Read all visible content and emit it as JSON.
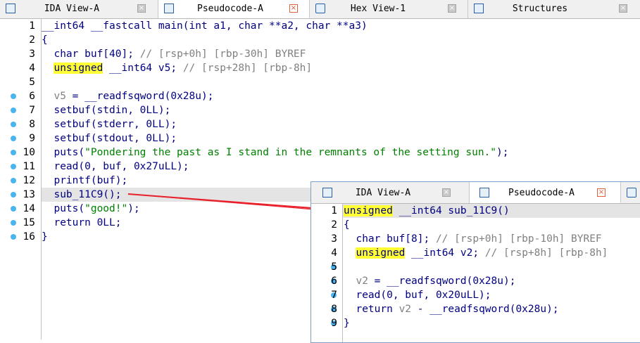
{
  "main_tabs": [
    {
      "label": "IDA View-A",
      "icon": "graph-view-icon",
      "active": false
    },
    {
      "label": "Pseudocode-A",
      "icon": "pseudocode-icon",
      "active": true
    },
    {
      "label": "Hex View-1",
      "icon": "hex-view-icon",
      "active": false
    },
    {
      "label": "Structures",
      "icon": "structures-icon",
      "active": false
    }
  ],
  "main_code": {
    "line_numbers": [
      "1",
      "2",
      "3",
      "4",
      "5",
      "6",
      "7",
      "8",
      "9",
      "10",
      "11",
      "12",
      "13",
      "14",
      "15",
      "16"
    ],
    "lines": [
      [
        {
          "t": "__int64 __fastcall main(int a1, char **a2, char **a3)",
          "c": ""
        }
      ],
      [
        {
          "t": "{",
          "c": ""
        }
      ],
      [
        {
          "t": "  char buf[40]; ",
          "c": ""
        },
        {
          "t": "// [rsp+0h] [rbp-30h] BYREF",
          "c": "cm"
        }
      ],
      [
        {
          "t": "  ",
          "c": ""
        },
        {
          "t": "unsigned",
          "c": "kw"
        },
        {
          "t": " __int64 v5; ",
          "c": ""
        },
        {
          "t": "// [rsp+28h] [rbp-8h]",
          "c": "cm"
        }
      ],
      [
        {
          "t": "",
          "c": ""
        }
      ],
      [
        {
          "t": "  ",
          "c": ""
        },
        {
          "t": "v5",
          "c": "var"
        },
        {
          "t": " = __readfsqword(0x28u);",
          "c": ""
        }
      ],
      [
        {
          "t": "  setbuf(stdin, 0LL);",
          "c": ""
        }
      ],
      [
        {
          "t": "  setbuf(stderr, 0LL);",
          "c": ""
        }
      ],
      [
        {
          "t": "  setbuf(stdout, 0LL);",
          "c": ""
        }
      ],
      [
        {
          "t": "  puts(",
          "c": ""
        },
        {
          "t": "\"Pondering the past as I stand in the remnants of the setting sun.\"",
          "c": "str"
        },
        {
          "t": ");",
          "c": ""
        }
      ],
      [
        {
          "t": "  read(0, buf, 0x27uLL);",
          "c": ""
        }
      ],
      [
        {
          "t": "  printf(buf);",
          "c": ""
        }
      ],
      [
        {
          "t": "  sub_11C9();",
          "c": ""
        }
      ],
      [
        {
          "t": "  puts(",
          "c": ""
        },
        {
          "t": "\"good!\"",
          "c": "str"
        },
        {
          "t": ");",
          "c": ""
        }
      ],
      [
        {
          "t": "  return 0LL;",
          "c": ""
        }
      ],
      [
        {
          "t": "}",
          "c": ""
        }
      ]
    ],
    "breakpoint_lines": [
      6,
      7,
      8,
      9,
      10,
      11,
      12,
      13,
      14,
      15,
      16
    ],
    "highlighted_line": 13
  },
  "popup_tabs": [
    {
      "label": "IDA View-A",
      "icon": "graph-view-icon",
      "active": false
    },
    {
      "label": "Pseudocode-A",
      "icon": "pseudocode-icon",
      "active": true
    }
  ],
  "popup_code": {
    "line_numbers": [
      "1",
      "2",
      "3",
      "4",
      "5",
      "6",
      "7",
      "8",
      "9"
    ],
    "lines": [
      [
        {
          "t": "unsigned",
          "c": "kw"
        },
        {
          "t": " __int64 sub_11C9()",
          "c": ""
        }
      ],
      [
        {
          "t": "{",
          "c": ""
        }
      ],
      [
        {
          "t": "  char buf[8]; ",
          "c": ""
        },
        {
          "t": "// [rsp+0h] [rbp-10h] BYREF",
          "c": "cm"
        }
      ],
      [
        {
          "t": "  ",
          "c": ""
        },
        {
          "t": "unsigned",
          "c": "kw"
        },
        {
          "t": " __int64 v2; ",
          "c": ""
        },
        {
          "t": "// [rsp+8h] [rbp-8h]",
          "c": "cm"
        }
      ],
      [
        {
          "t": "",
          "c": ""
        }
      ],
      [
        {
          "t": "  ",
          "c": ""
        },
        {
          "t": "v2",
          "c": "var"
        },
        {
          "t": " = __readfsqword(0x28u);",
          "c": ""
        }
      ],
      [
        {
          "t": "  read(0, buf, 0x20uLL);",
          "c": ""
        }
      ],
      [
        {
          "t": "  return ",
          "c": ""
        },
        {
          "t": "v2",
          "c": "var"
        },
        {
          "t": " - __readfsqword(0x28u);",
          "c": ""
        }
      ],
      [
        {
          "t": "}",
          "c": ""
        }
      ]
    ],
    "breakpoint_lines": [
      5,
      6,
      7,
      8,
      9
    ],
    "highlighted_line": 1
  },
  "colors": {
    "annotation_arrow": "#e8202a",
    "breakpoint_dot": "#48b4f0",
    "keyword_highlight": "#ffff33",
    "string": "#008000",
    "comment": "#808080",
    "code_text": "#000080"
  }
}
